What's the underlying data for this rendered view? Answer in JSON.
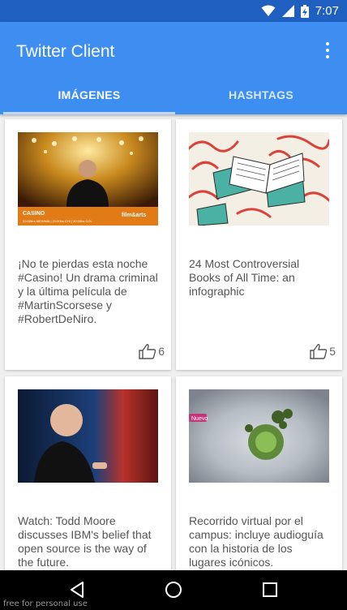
{
  "statusbar": {
    "time": "7:07"
  },
  "appbar": {
    "title": "Twitter Client"
  },
  "tabs": [
    {
      "label": "IMÁGENES",
      "selected": true
    },
    {
      "label": "HASHTAGS",
      "selected": false
    }
  ],
  "cards": [
    {
      "text": "¡No te pierdas esta noche #Casino! Un drama criminal y la última película de #MartinScorsese y #RobertDeNiro.",
      "likes": "6",
      "image_caption": "CASINO",
      "image_schedule": "22:00hrs MEX/MIA | 21:00hs CHI | 20:00hs COL",
      "image_brand": "film&arts"
    },
    {
      "text": "24 Most Controversial Books of All Time: an infographic",
      "likes": "5"
    },
    {
      "text": "Watch: Todd Moore discusses IBM's belief that open source is the way of the future.",
      "likes": ""
    },
    {
      "text": "Recorrido virtual por el campus: incluye audioguía con la historia de los lugares icónicos.",
      "likes": "",
      "image_tag": "Nuevo"
    }
  ],
  "watermark": "free for personal use",
  "colors": {
    "statusbar": "#1e5fbf",
    "appbar": "#3d8ef0",
    "navbar": "#000000"
  }
}
